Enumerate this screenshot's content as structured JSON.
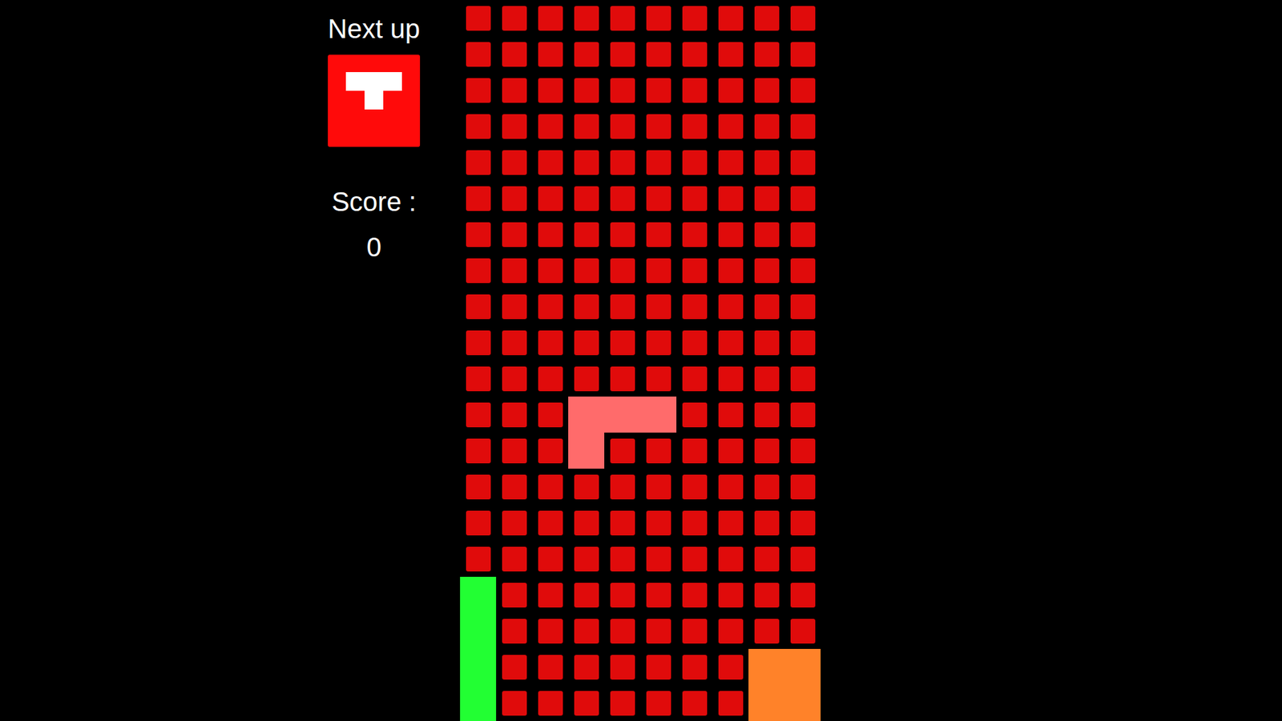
{
  "next_up": {
    "label": "Next up",
    "cells": [
      [
        0,
        0
      ],
      [
        0,
        1
      ],
      [
        0,
        2
      ],
      [
        1,
        1
      ]
    ]
  },
  "score": {
    "label": "Score :",
    "value": "0"
  },
  "board": {
    "columns": 10,
    "rows": 20,
    "pieces": [
      {
        "kind": "L",
        "active": true,
        "color": "#ff6b6b",
        "cells": [
          [
            11,
            3
          ],
          [
            11,
            4
          ],
          [
            11,
            5
          ],
          [
            12,
            3
          ]
        ]
      },
      {
        "kind": "I",
        "active": false,
        "color": "#22ff33",
        "cells": [
          [
            16,
            0
          ],
          [
            17,
            0
          ],
          [
            18,
            0
          ],
          [
            19,
            0
          ]
        ]
      },
      {
        "kind": "O",
        "active": false,
        "color": "#ff8229",
        "cells": [
          [
            18,
            8
          ],
          [
            18,
            9
          ],
          [
            19,
            8
          ],
          [
            19,
            9
          ]
        ]
      }
    ]
  }
}
